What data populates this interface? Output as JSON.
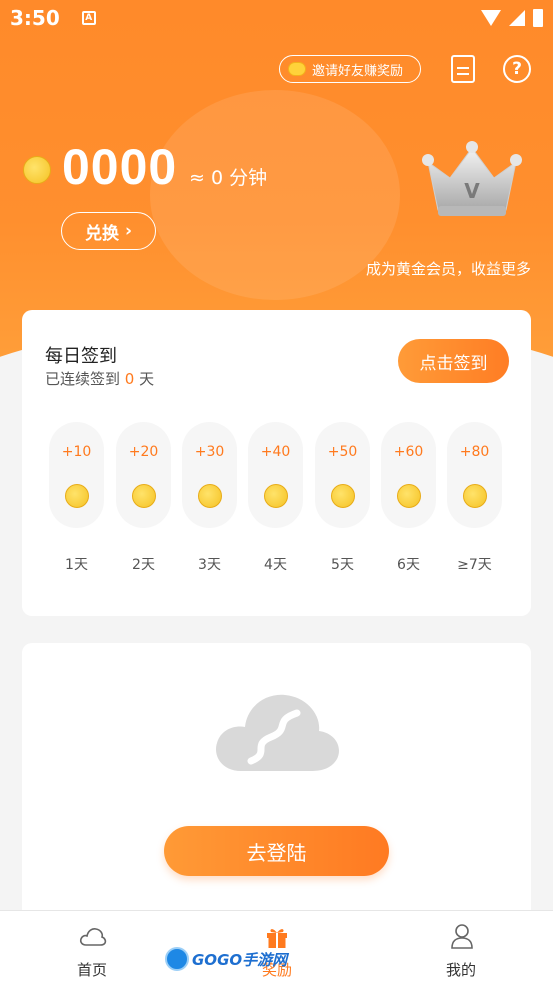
{
  "status_bar": {
    "time": "3:50",
    "notification_icon": "A"
  },
  "header": {
    "invite_label": "邀请好友赚奖励",
    "doc_icon": "document-icon",
    "help_icon": "?"
  },
  "wallet": {
    "balance": "0000",
    "minutes_text": "≈ 0 分钟",
    "exchange_label": "兑换",
    "exchange_chevron": "›",
    "vip_promo": "成为黄金会员，收益更多"
  },
  "daily_signin": {
    "title": "每日签到",
    "streak_prefix": "已连续签到 ",
    "streak_count": "0",
    "streak_suffix": " 天",
    "button_label": "点击签到",
    "days": [
      {
        "bonus": "+10",
        "label": "1天"
      },
      {
        "bonus": "+20",
        "label": "2天"
      },
      {
        "bonus": "+30",
        "label": "3天"
      },
      {
        "bonus": "+40",
        "label": "4天"
      },
      {
        "bonus": "+50",
        "label": "5天"
      },
      {
        "bonus": "+60",
        "label": "6天"
      },
      {
        "bonus": "+80",
        "label": "≥7天"
      }
    ]
  },
  "login_card": {
    "button_label": "去登陆"
  },
  "tabbar": {
    "tabs": [
      {
        "label": "首页",
        "icon": "cloud-icon"
      },
      {
        "label": "奖励",
        "icon": "gift-icon"
      },
      {
        "label": "我的",
        "icon": "user-icon"
      }
    ]
  },
  "watermark": {
    "text": "GOGO手游网"
  },
  "colors": {
    "accent": "#ff7a1e",
    "hero_orange": "#ff8a2a",
    "coin_gold": "#f5c224"
  }
}
